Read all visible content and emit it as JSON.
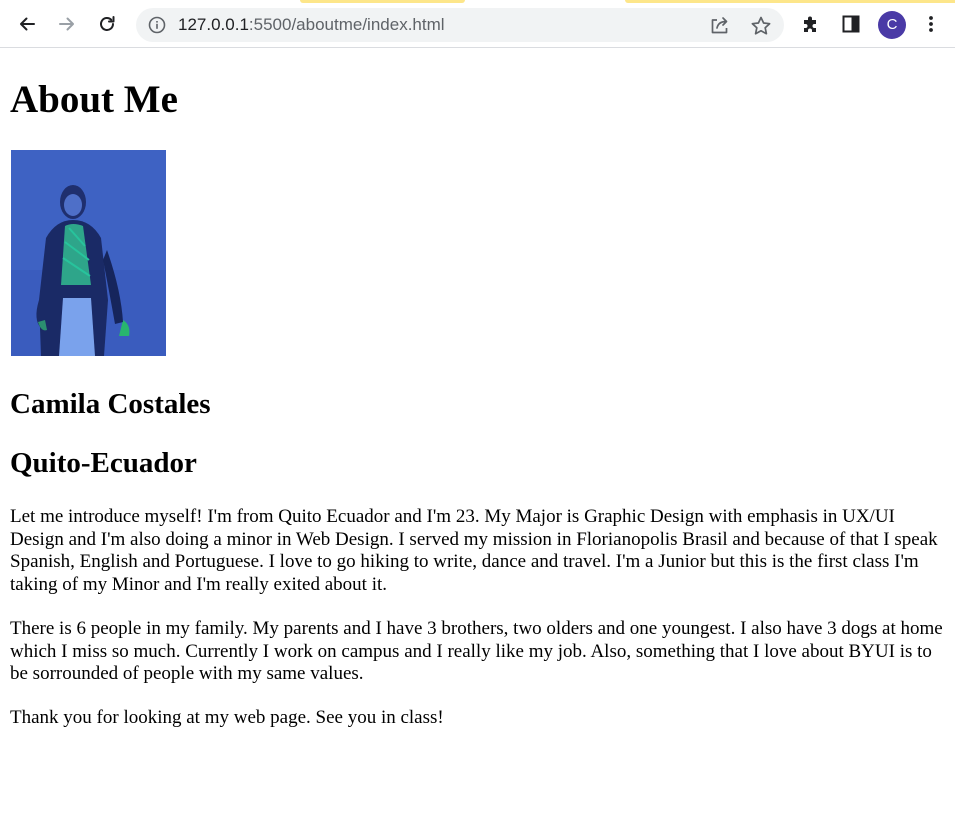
{
  "browser": {
    "url_host": "127.0.0.1",
    "url_path": ":5500/aboutme/index.html",
    "profile_initial": "C",
    "icons": {
      "back": "arrow-left-icon",
      "forward": "arrow-right-icon",
      "reload": "reload-icon",
      "site_info": "info-icon",
      "share": "share-icon",
      "bookmark": "star-icon",
      "extensions": "puzzle-icon",
      "side_panel": "side-panel-icon",
      "menu": "kebab-menu-icon"
    },
    "colors": {
      "omnibox_bg": "#f1f3f4",
      "avatar_bg": "#4a3aa6",
      "tab_accent": "#fde68a"
    }
  },
  "page": {
    "title": "About Me",
    "name": "Camila Costales",
    "location": "Quito-Ecuador",
    "paragraphs": [
      "Let me introduce myself! I'm from Quito Ecuador and I'm 23. My Major is Graphic Design with emphasis in UX/UI Design and I'm also doing a minor in Web Design. I served my mission in Florianopolis Brasil and because of that I speak Spanish, English and Portuguese. I love to go hiking to write, dance and travel. I'm a Junior but this is the first class I'm taking of my Minor and I'm really exited about it.",
      "There is 6 people in my family. My parents and I have 3 brothers, two olders and one youngest. I also have 3 dogs at home which I miss so much. Currently I work on campus and I really like my job. Also, something that I love about BYUI is to be sorrounded of people with my same values.",
      "Thank you for looking at my web page. See you in class!"
    ]
  }
}
